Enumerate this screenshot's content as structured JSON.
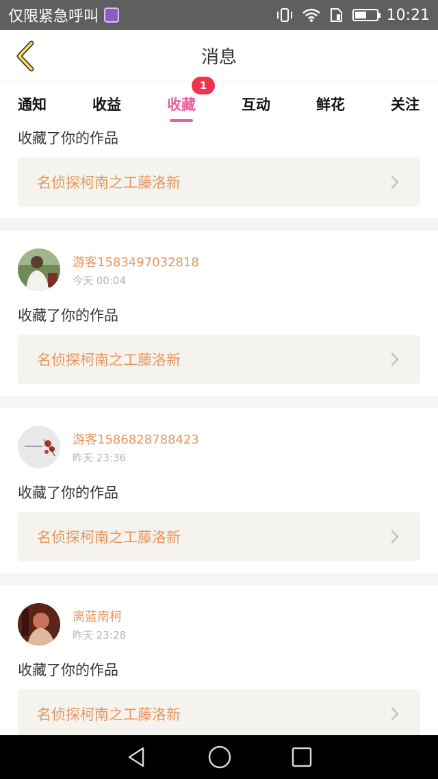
{
  "status_bar": {
    "carrier": "仅限紧急呼叫",
    "time": "10:21",
    "icons": [
      "gallery-icon",
      "vibrate-icon",
      "wifi-icon",
      "sim-icon",
      "battery-icon"
    ],
    "battery_level": 0.55
  },
  "header": {
    "title": "消息",
    "back_icon": "chevron-left-icon"
  },
  "tabs": [
    {
      "label": "通知"
    },
    {
      "label": "收益"
    },
    {
      "label": "收藏",
      "active": true,
      "badge": "1"
    },
    {
      "label": "互动"
    },
    {
      "label": "鲜花"
    },
    {
      "label": "关注"
    }
  ],
  "feed": [
    {
      "message": "收藏了你的作品",
      "work_title": "名侦探柯南之工藤洛新"
    },
    {
      "user": "游客1583497032818",
      "time": "今天 00:04",
      "message": "收藏了你的作品",
      "work_title": "名侦探柯南之工藤洛新"
    },
    {
      "user": "游客1586828788423",
      "time": "昨天 23:36",
      "message": "收藏了你的作品",
      "work_title": "名侦探柯南之工藤洛新"
    },
    {
      "user": "离蓝南柯",
      "time": "昨天 23:28",
      "message": "收藏了你的作品",
      "work_title": "名侦探柯南之工藤洛新"
    }
  ],
  "colors": {
    "accent_pink": "#e8609a",
    "orange_text": "#e8955a",
    "badge_red": "#f0334a",
    "card_bg": "#f4f3ee"
  },
  "nav_bar": [
    "back-triangle-icon",
    "home-circle-icon",
    "recents-square-icon"
  ]
}
